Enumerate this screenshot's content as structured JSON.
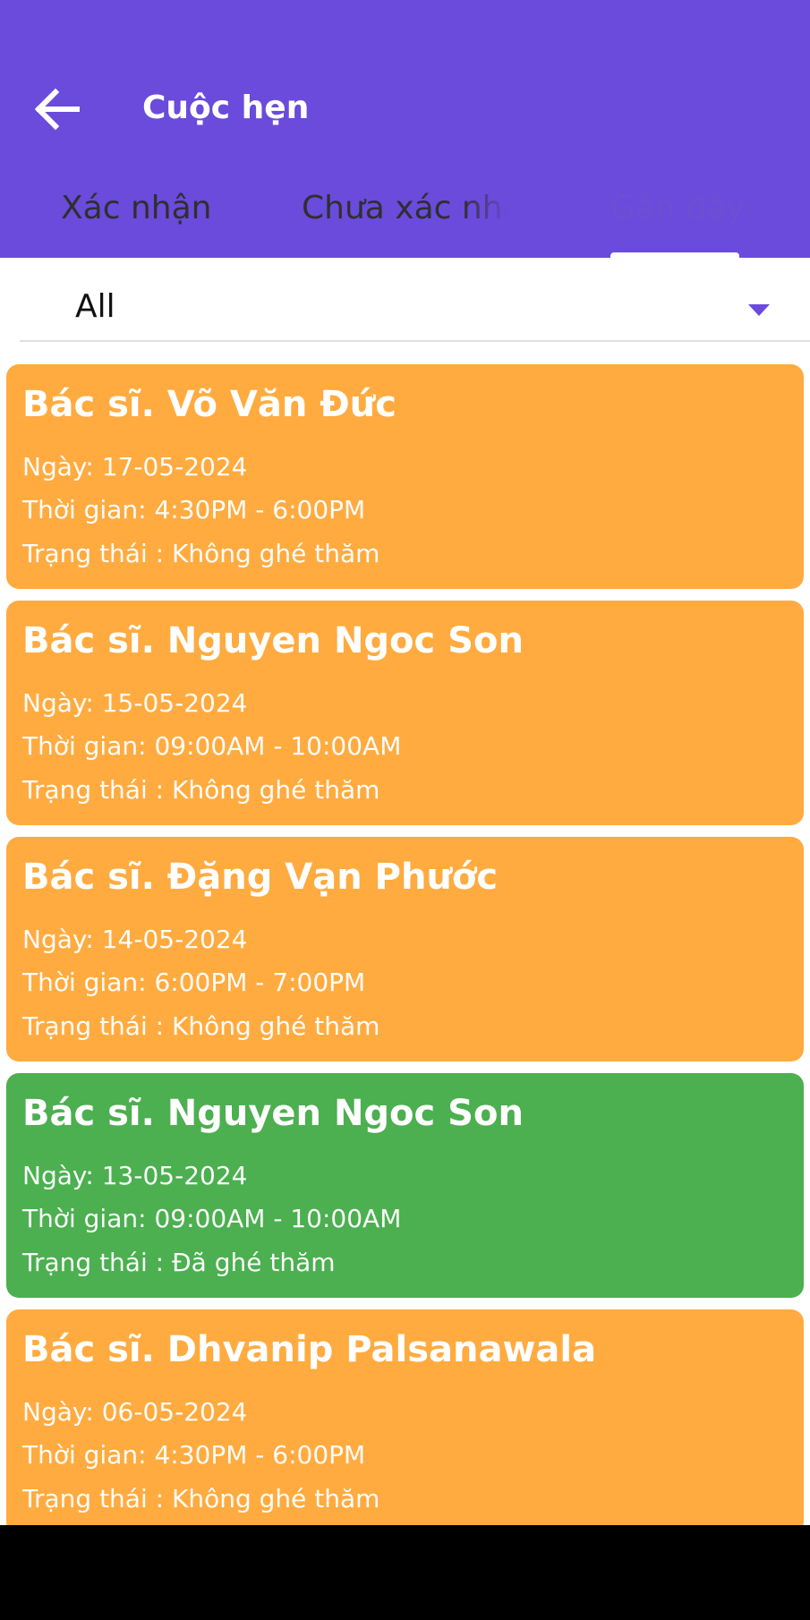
{
  "header": {
    "title": "Cuộc hẹn",
    "back_icon": "arrow-left-icon"
  },
  "tabs": [
    {
      "label": "Xác nhận"
    },
    {
      "label": "Chưa xác nhận"
    },
    {
      "label": "Gần đây",
      "selected": true
    }
  ],
  "filter": {
    "value": "All",
    "arrow_icon": "dropdown-arrow-icon"
  },
  "colors": {
    "primary": "#6a4bdc",
    "not_visited": "#ffab40",
    "visited": "#4caf50"
  },
  "appointments": [
    {
      "doctor": "Bác sĩ. Võ Văn Đức",
      "date": "Ngày: 17-05-2024",
      "time": "Thời gian: 4:30PM - 6:00PM",
      "status": "Trạng thái : Không ghé thăm",
      "color": "#ffab40"
    },
    {
      "doctor": "Bác sĩ. Nguyen Ngoc Son",
      "date": "Ngày: 15-05-2024",
      "time": "Thời gian: 09:00AM - 10:00AM",
      "status": "Trạng thái : Không ghé thăm",
      "color": "#ffab40"
    },
    {
      "doctor": "Bác sĩ. Đặng Vạn Phước",
      "date": "Ngày: 14-05-2024",
      "time": "Thời gian: 6:00PM - 7:00PM",
      "status": "Trạng thái : Không ghé thăm",
      "color": "#ffab40"
    },
    {
      "doctor": "Bác sĩ. Nguyen Ngoc Son",
      "date": "Ngày: 13-05-2024",
      "time": "Thời gian: 09:00AM - 10:00AM",
      "status": "Trạng thái : Đã ghé thăm",
      "color": "#4caf50"
    },
    {
      "doctor": "Bác sĩ. Dhvanip Palsanawala",
      "date": "Ngày: 06-05-2024",
      "time": "Thời gian: 4:30PM - 6:00PM",
      "status": "Trạng thái : Không ghé thăm",
      "color": "#ffab40"
    }
  ]
}
